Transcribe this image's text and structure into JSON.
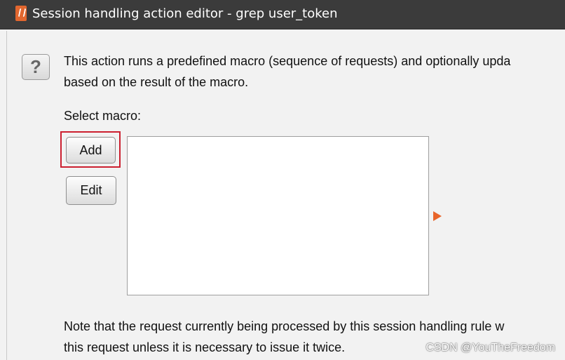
{
  "window": {
    "title": "Session handling action editor - grep user_token",
    "app_icon": "burp-suite-icon"
  },
  "help": {
    "label": "?"
  },
  "description": {
    "line1": "This action runs a predefined macro (sequence of requests) and optionally upda",
    "line2": "based on the result of the macro."
  },
  "macro": {
    "label": "Select macro:",
    "add_label": "Add",
    "edit_label": "Edit",
    "items": []
  },
  "note": {
    "line1": "Note that the request currently being processed by this session handling rule w",
    "line2": "this request unless it is necessary to issue it twice."
  },
  "watermark": "CSDN @YouTheFreedom",
  "colors": {
    "titlebar": "#3b3b3b",
    "highlight": "#cc2030",
    "accent_arrow": "#e8652a"
  }
}
